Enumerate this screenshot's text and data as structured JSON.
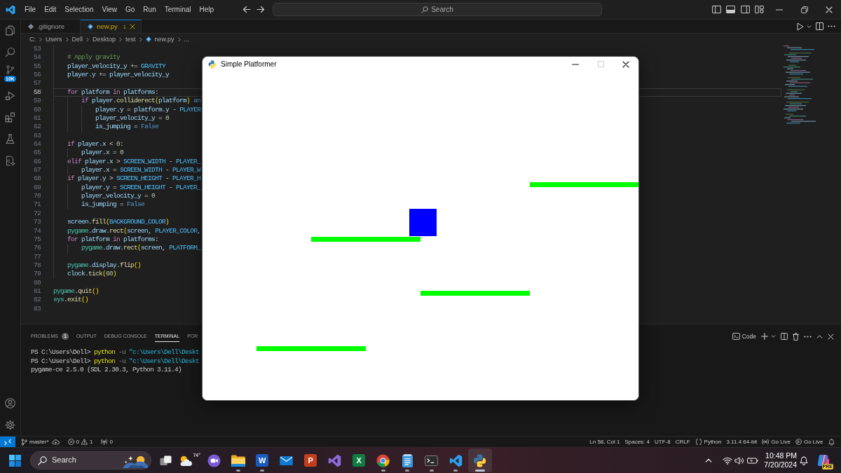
{
  "title_bar": {
    "menu": [
      "File",
      "Edit",
      "Selection",
      "View",
      "Go",
      "Run",
      "Terminal",
      "Help"
    ],
    "search": "Search"
  },
  "activity_bar": {
    "source_control_badge": "10K"
  },
  "editor": {
    "tabs": [
      {
        "label": ".gitignore",
        "selected": false
      },
      {
        "label": "new.py",
        "selected": true,
        "problems": "1"
      }
    ],
    "breadcrumb": [
      {
        "text": "C:",
        "kind": "folder"
      },
      {
        "text": "Users",
        "kind": "folder"
      },
      {
        "text": "Dell",
        "kind": "folder"
      },
      {
        "text": "Desktop",
        "kind": "folder"
      },
      {
        "text": "test",
        "kind": "folder"
      },
      {
        "text": "new.py",
        "kind": "file"
      },
      {
        "text": "...",
        "kind": "more"
      }
    ],
    "lines": [
      {
        "number": "53",
        "current": false
      },
      {
        "number": "54",
        "current": false,
        "tokens": [
          {
            "text": "    # Apply gravity",
            "kind": "comment"
          }
        ]
      },
      {
        "number": "55",
        "current": false,
        "tokens": [
          {
            "text": "    player_velocity_y",
            "kind": "variable"
          },
          {
            "text": " += ",
            "kind": "plain"
          },
          {
            "text": "GRAVITY",
            "kind": "constant"
          }
        ]
      },
      {
        "number": "56",
        "current": false,
        "tokens": [
          {
            "text": "    player",
            "kind": "variable"
          },
          {
            "text": ".",
            "kind": "plain"
          },
          {
            "text": "y",
            "kind": "variable"
          },
          {
            "text": " += ",
            "kind": "plain"
          },
          {
            "text": "player_velocity_y",
            "kind": "variable"
          }
        ]
      },
      {
        "number": "57",
        "current": false
      },
      {
        "number": "58",
        "current": true,
        "tokens": [
          {
            "text": "    for ",
            "kind": "keyword"
          },
          {
            "text": "platform ",
            "kind": "variable"
          },
          {
            "text": "in ",
            "kind": "keyword"
          },
          {
            "text": "platforms",
            "kind": "variable"
          },
          {
            "text": ":",
            "kind": "plain"
          }
        ]
      },
      {
        "number": "59",
        "current": false,
        "tokens": [
          {
            "text": "        if ",
            "kind": "keyword"
          },
          {
            "text": "player",
            "kind": "variable"
          },
          {
            "text": ".",
            "kind": "plain"
          },
          {
            "text": "colliderect",
            "kind": "function"
          },
          {
            "text": "(",
            "kind": "bracket"
          },
          {
            "text": "platform",
            "kind": "variable"
          },
          {
            "text": ") ",
            "kind": "bracket"
          },
          {
            "text": "an",
            "kind": "literal"
          }
        ]
      },
      {
        "number": "60",
        "current": false,
        "tokens": [
          {
            "text": "            player",
            "kind": "variable"
          },
          {
            "text": ".",
            "kind": "plain"
          },
          {
            "text": "y",
            "kind": "variable"
          },
          {
            "text": " = ",
            "kind": "plain"
          },
          {
            "text": "platform",
            "kind": "variable"
          },
          {
            "text": ".",
            "kind": "plain"
          },
          {
            "text": "y",
            "kind": "variable"
          },
          {
            "text": " - ",
            "kind": "plain"
          },
          {
            "text": "PLAYER",
            "kind": "constant"
          }
        ]
      },
      {
        "number": "61",
        "current": false,
        "tokens": [
          {
            "text": "            player_velocity_y",
            "kind": "variable"
          },
          {
            "text": " = ",
            "kind": "plain"
          },
          {
            "text": "0",
            "kind": "number"
          }
        ]
      },
      {
        "number": "62",
        "current": false,
        "tokens": [
          {
            "text": "            is_jumping",
            "kind": "variable"
          },
          {
            "text": " = ",
            "kind": "plain"
          },
          {
            "text": "False",
            "kind": "literal"
          }
        ]
      },
      {
        "number": "63",
        "current": false
      },
      {
        "number": "64",
        "current": false,
        "tokens": [
          {
            "text": "    if ",
            "kind": "keyword"
          },
          {
            "text": "player",
            "kind": "variable"
          },
          {
            "text": ".",
            "kind": "plain"
          },
          {
            "text": "x",
            "kind": "variable"
          },
          {
            "text": " < ",
            "kind": "plain"
          },
          {
            "text": "0",
            "kind": "number"
          },
          {
            "text": ":",
            "kind": "plain"
          }
        ]
      },
      {
        "number": "65",
        "current": false,
        "tokens": [
          {
            "text": "        player",
            "kind": "variable"
          },
          {
            "text": ".",
            "kind": "plain"
          },
          {
            "text": "x",
            "kind": "variable"
          },
          {
            "text": " = ",
            "kind": "plain"
          },
          {
            "text": "0",
            "kind": "number"
          }
        ]
      },
      {
        "number": "66",
        "current": false,
        "tokens": [
          {
            "text": "    elif ",
            "kind": "keyword"
          },
          {
            "text": "player",
            "kind": "variable"
          },
          {
            "text": ".",
            "kind": "plain"
          },
          {
            "text": "x",
            "kind": "variable"
          },
          {
            "text": " > ",
            "kind": "plain"
          },
          {
            "text": "SCREEN_WIDTH",
            "kind": "constant"
          },
          {
            "text": " - ",
            "kind": "plain"
          },
          {
            "text": "PLAYER_",
            "kind": "constant"
          }
        ]
      },
      {
        "number": "67",
        "current": false,
        "tokens": [
          {
            "text": "        player",
            "kind": "variable"
          },
          {
            "text": ".",
            "kind": "plain"
          },
          {
            "text": "x",
            "kind": "variable"
          },
          {
            "text": " = ",
            "kind": "plain"
          },
          {
            "text": "SCREEN_WIDTH",
            "kind": "constant"
          },
          {
            "text": " - ",
            "kind": "plain"
          },
          {
            "text": "PLAYER_W",
            "kind": "constant"
          }
        ]
      },
      {
        "number": "68",
        "current": false,
        "tokens": [
          {
            "text": "    if ",
            "kind": "keyword"
          },
          {
            "text": "player",
            "kind": "variable"
          },
          {
            "text": ".",
            "kind": "plain"
          },
          {
            "text": "y",
            "kind": "variable"
          },
          {
            "text": " > ",
            "kind": "plain"
          },
          {
            "text": "SCREEN_HEIGHT",
            "kind": "constant"
          },
          {
            "text": " - ",
            "kind": "plain"
          },
          {
            "text": "PLAYER_H",
            "kind": "constant"
          }
        ]
      },
      {
        "number": "69",
        "current": false,
        "tokens": [
          {
            "text": "        player",
            "kind": "variable"
          },
          {
            "text": ".",
            "kind": "plain"
          },
          {
            "text": "y",
            "kind": "variable"
          },
          {
            "text": " = ",
            "kind": "plain"
          },
          {
            "text": "SCREEN_HEIGHT",
            "kind": "constant"
          },
          {
            "text": " - ",
            "kind": "plain"
          },
          {
            "text": "PLAYER_",
            "kind": "constant"
          }
        ]
      },
      {
        "number": "70",
        "current": false,
        "tokens": [
          {
            "text": "        player_velocity_y",
            "kind": "variable"
          },
          {
            "text": " = ",
            "kind": "plain"
          },
          {
            "text": "0",
            "kind": "number"
          }
        ]
      },
      {
        "number": "71",
        "current": false,
        "tokens": [
          {
            "text": "        is_jumping",
            "kind": "variable"
          },
          {
            "text": " = ",
            "kind": "plain"
          },
          {
            "text": "False",
            "kind": "literal"
          }
        ]
      },
      {
        "number": "72",
        "current": false
      },
      {
        "number": "73",
        "current": false,
        "tokens": [
          {
            "text": "    screen",
            "kind": "variable"
          },
          {
            "text": ".",
            "kind": "plain"
          },
          {
            "text": "fill",
            "kind": "function"
          },
          {
            "text": "(",
            "kind": "bracket"
          },
          {
            "text": "BACKGROUND_COLOR",
            "kind": "constant"
          },
          {
            "text": ")",
            "kind": "bracket"
          }
        ]
      },
      {
        "number": "74",
        "current": false,
        "tokens": [
          {
            "text": "    pygame",
            "kind": "module"
          },
          {
            "text": ".",
            "kind": "plain"
          },
          {
            "text": "draw",
            "kind": "variable"
          },
          {
            "text": ".",
            "kind": "plain"
          },
          {
            "text": "rect",
            "kind": "function"
          },
          {
            "text": "(",
            "kind": "bracket"
          },
          {
            "text": "screen",
            "kind": "variable"
          },
          {
            "text": ", ",
            "kind": "plain"
          },
          {
            "text": "PLAYER_COLOR",
            "kind": "constant"
          },
          {
            "text": ",",
            "kind": "plain"
          }
        ]
      },
      {
        "number": "75",
        "current": false,
        "tokens": [
          {
            "text": "    for ",
            "kind": "keyword"
          },
          {
            "text": "platform ",
            "kind": "variable"
          },
          {
            "text": "in ",
            "kind": "keyword"
          },
          {
            "text": "platforms",
            "kind": "variable"
          },
          {
            "text": ":",
            "kind": "plain"
          }
        ]
      },
      {
        "number": "76",
        "current": false,
        "tokens": [
          {
            "text": "        pygame",
            "kind": "module"
          },
          {
            "text": ".",
            "kind": "plain"
          },
          {
            "text": "draw",
            "kind": "variable"
          },
          {
            "text": ".",
            "kind": "plain"
          },
          {
            "text": "rect",
            "kind": "function"
          },
          {
            "text": "(",
            "kind": "bracket"
          },
          {
            "text": "screen",
            "kind": "variable"
          },
          {
            "text": ", ",
            "kind": "plain"
          },
          {
            "text": "PLATFORM_",
            "kind": "constant"
          }
        ]
      },
      {
        "number": "77",
        "current": false
      },
      {
        "number": "78",
        "current": false,
        "tokens": [
          {
            "text": "    pygame",
            "kind": "module"
          },
          {
            "text": ".",
            "kind": "plain"
          },
          {
            "text": "display",
            "kind": "variable"
          },
          {
            "text": ".",
            "kind": "plain"
          },
          {
            "text": "flip",
            "kind": "function"
          },
          {
            "text": "()",
            "kind": "bracket"
          }
        ]
      },
      {
        "number": "79",
        "current": false,
        "tokens": [
          {
            "text": "    clock",
            "kind": "variable"
          },
          {
            "text": ".",
            "kind": "plain"
          },
          {
            "text": "tick",
            "kind": "function"
          },
          {
            "text": "(",
            "kind": "bracket"
          },
          {
            "text": "60",
            "kind": "number"
          },
          {
            "text": ")",
            "kind": "bracket"
          }
        ]
      },
      {
        "number": "80",
        "current": false
      },
      {
        "number": "81",
        "current": false,
        "tokens": [
          {
            "text": "pygame",
            "kind": "module"
          },
          {
            "text": ".",
            "kind": "plain"
          },
          {
            "text": "quit",
            "kind": "function"
          },
          {
            "text": "()",
            "kind": "bracket"
          }
        ]
      },
      {
        "number": "82",
        "current": false,
        "tokens": [
          {
            "text": "sys",
            "kind": "module"
          },
          {
            "text": ".",
            "kind": "plain"
          },
          {
            "text": "exit",
            "kind": "function"
          },
          {
            "text": "()",
            "kind": "bracket"
          }
        ]
      },
      {
        "number": "83",
        "current": false
      }
    ]
  },
  "panel": {
    "tabs": [
      {
        "label": "PROBLEMS",
        "selected": false,
        "count": "1"
      },
      {
        "label": "OUTPUT",
        "selected": false
      },
      {
        "label": "DEBUG CONSOLE",
        "selected": false
      },
      {
        "label": "TERMINAL",
        "selected": true
      },
      {
        "label": "POR",
        "selected": false
      }
    ],
    "terminal_name": "Code",
    "terminal_lines": [
      {
        "tokens": [
          {
            "text": "PS C:\\Users\\Dell> ",
            "kind": "plain"
          },
          {
            "text": "python",
            "kind": "command"
          },
          {
            "text": " -u ",
            "kind": "parameter"
          },
          {
            "text": "\"c:\\Users\\Dell\\Deskt",
            "kind": "string"
          }
        ]
      },
      {
        "tokens": [
          {
            "text": "PS C:\\Users\\Dell> ",
            "kind": "plain"
          },
          {
            "text": "python",
            "kind": "command"
          },
          {
            "text": " -u ",
            "kind": "parameter"
          },
          {
            "text": "\"c:\\Users\\Dell\\Deskt",
            "kind": "string"
          }
        ]
      },
      {
        "tokens": [
          {
            "text": "pygame-ce 2.5.0 (SDL 2.30.3, Python 3.11.4)",
            "kind": "plain"
          }
        ]
      }
    ]
  },
  "game_window": {
    "title": "Simple Platformer",
    "maximize_disabled": true
  },
  "status_bar": {
    "branch": "master*",
    "errors": "0",
    "warnings": "1",
    "ports": "0",
    "position": "Ln 58, Col 1",
    "indentation": "Spaces: 4",
    "encoding": "UTF-8",
    "line_ending": "CRLF",
    "language": "Python",
    "interpreter": "3.11.4 64-bit",
    "live_servers": [
      "Go Live",
      "Go Live"
    ]
  },
  "taskbar": {
    "search": "Search",
    "apps": [
      {
        "kind": "task_view",
        "running": false,
        "selected": false
      },
      {
        "kind": "weather",
        "label": "74°",
        "running": false,
        "selected": false
      },
      {
        "kind": "chat",
        "running": false,
        "selected": false
      },
      {
        "kind": "files",
        "running": true,
        "selected": false
      },
      {
        "kind": "document",
        "letter": "W",
        "running": true,
        "selected": false
      },
      {
        "kind": "mail",
        "running": false,
        "selected": false
      },
      {
        "kind": "slides",
        "letter": "P",
        "running": false,
        "selected": false
      },
      {
        "kind": "ide",
        "running": false,
        "selected": false
      },
      {
        "kind": "spreadsheet",
        "letter": "X",
        "running": false,
        "selected": false
      },
      {
        "kind": "browser",
        "running": true,
        "selected": false
      },
      {
        "kind": "notepad",
        "running": true,
        "selected": false
      },
      {
        "kind": "terminal",
        "running": true,
        "selected": false
      },
      {
        "kind": "code",
        "running": true,
        "selected": false
      },
      {
        "kind": "python",
        "running": true,
        "selected": true
      }
    ],
    "time": "10:48 PM",
    "date": "7/20/2024",
    "assistant_badge": "PRE"
  }
}
